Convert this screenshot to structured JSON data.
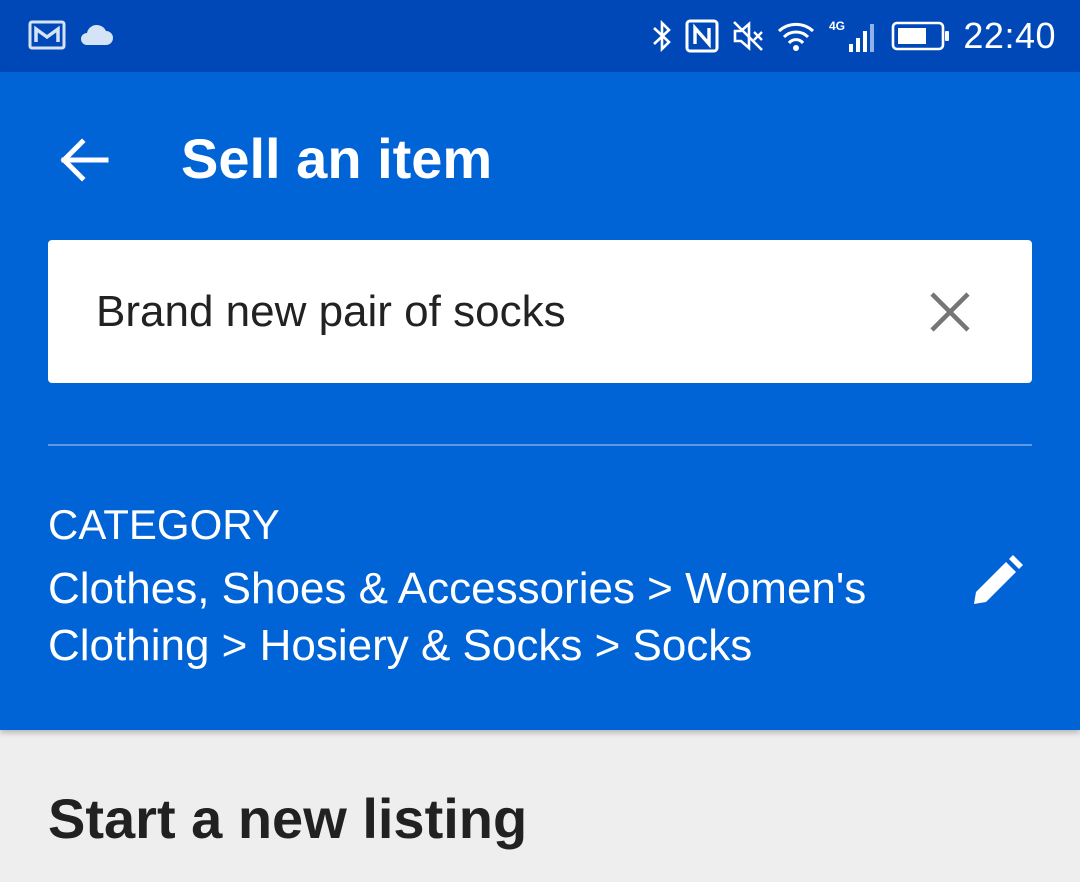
{
  "status_bar": {
    "time": "22:40",
    "network_type": "4G",
    "icons_left": [
      "gallery-notification-icon",
      "cloud-icon"
    ],
    "icons_right": [
      "bluetooth-icon",
      "nfc-icon",
      "mute-icon",
      "wifi-icon",
      "cellular-signal-icon",
      "battery-icon"
    ],
    "background": "#0048b8"
  },
  "header": {
    "title": "Sell an item",
    "background": "#0063d6"
  },
  "search": {
    "value": "Brand new pair of socks",
    "clear_icon": "close-icon"
  },
  "category": {
    "label": "CATEGORY",
    "path": "Clothes, Shoes & Accessories > Women's Clothing > Hosiery & Socks > Socks",
    "edit_icon": "pencil-icon"
  },
  "section": {
    "title": "Start a new listing"
  }
}
